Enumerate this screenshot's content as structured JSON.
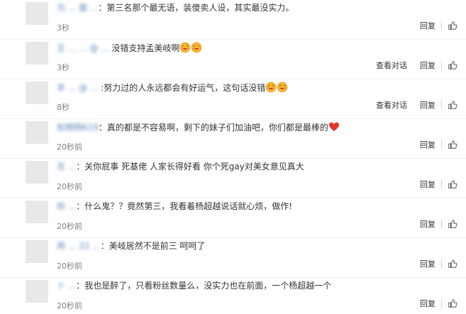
{
  "comments": [
    {
      "user": "为 ... 面 ...",
      "text": "：第三名那个最无语，装傻卖人设，其实最没实力。",
      "time": "3秒",
      "has_view_conversation": false
    },
    {
      "user": "王 ... ...",
      "mention": "@ ...",
      "text": "没错支持孟美岐啊",
      "time": "3秒",
      "has_view_conversation": true
    },
    {
      "user": "羊 ...",
      "mention": "@ ...",
      "text": ":努力过的人永远都会有好运气，这句话没错",
      "time": "8秒",
      "has_view_conversation": true
    },
    {
      "user": "权明明619",
      "text": "：真的都是不容易啊，剩下的妹子们加油吧，你们都是最棒的",
      "time": "20秒前",
      "has_view_conversation": false
    },
    {
      "user": "无 ...",
      "text": "：关你屁事 死基佬 人家长得好看 你个死gay对美女意见真大",
      "time": "20秒前",
      "has_view_conversation": false
    },
    {
      "user": "你 ...",
      "text": "：什么鬼？？竟然第三，我看着杨超越说话就心烦，做作!",
      "time": "20秒前",
      "has_view_conversation": false
    },
    {
      "user": "用 ... 22 ...",
      "text": "：美岐居然不是前三 呵呵了",
      "time": "20秒前",
      "has_view_conversation": false
    },
    {
      "user": "卜 ...",
      "text": "：我也是醉了，只看粉丝数量么，没实力也在前面，一个杨超越一个",
      "time": "20秒前",
      "has_view_conversation": false
    }
  ],
  "labels": {
    "view_conversation": "查看对话",
    "reply": "回复"
  },
  "icons": {
    "like": "thumbs-up-icon",
    "laugh_emoji": "grinning-emoji-icon",
    "heart": "red-heart-icon"
  },
  "colors": {
    "username": "#5a85b8",
    "time": "#808080",
    "heart": "#e0362b",
    "emoji": "#f5b52b"
  }
}
